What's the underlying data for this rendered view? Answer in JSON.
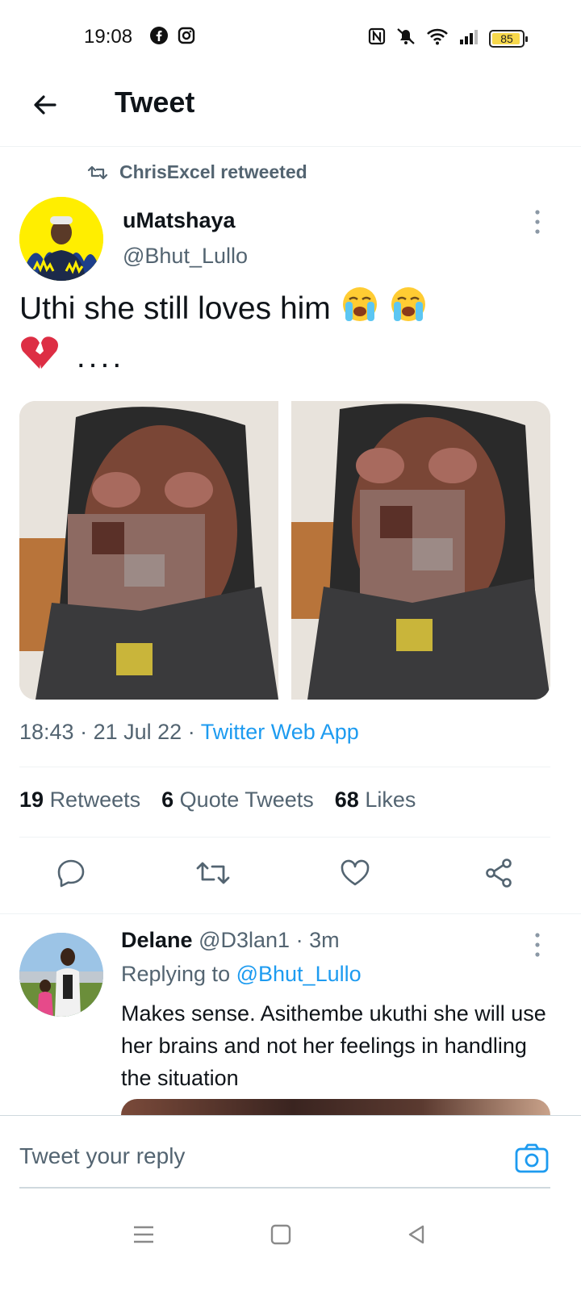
{
  "status_bar": {
    "time": "19:08",
    "battery": "85",
    "left_icons": [
      "facebook-icon",
      "instagram-icon"
    ],
    "right_icons": [
      "nfc-icon",
      "mute-icon",
      "wifi-icon",
      "signal-icon",
      "battery-icon"
    ]
  },
  "header": {
    "title": "Tweet"
  },
  "tweet": {
    "retweeted_by": "ChrisExcel retweeted",
    "author_name": "uMatshaya",
    "author_handle": "@Bhut_Lullo",
    "text_line1": "Uthi she still loves him",
    "text_line2_suffix": "....",
    "emojis": [
      "loudly-crying-face",
      "loudly-crying-face",
      "broken-heart"
    ],
    "media_count": 2,
    "time": "18:43",
    "date": "21 Jul 22",
    "source": "Twitter Web App",
    "stats": {
      "retweets_count": "19",
      "retweets_label": "Retweets",
      "quotes_count": "6",
      "quotes_label": "Quote Tweets",
      "likes_count": "68",
      "likes_label": "Likes"
    }
  },
  "reply": {
    "name": "Delane",
    "handle": "@D3lan1",
    "age": "3m",
    "replying_to_label": "Replying to",
    "replying_to_handle": "@Bhut_Lullo",
    "text": "Makes sense. Asithembe ukuthi she will use her brains and not her feelings in handling the situation"
  },
  "compose": {
    "placeholder": "Tweet your reply"
  },
  "colors": {
    "accent": "#1d9bf0",
    "muted_text": "#536471",
    "primary_text": "#0f1419",
    "avatar_bg": "#ffee00"
  }
}
